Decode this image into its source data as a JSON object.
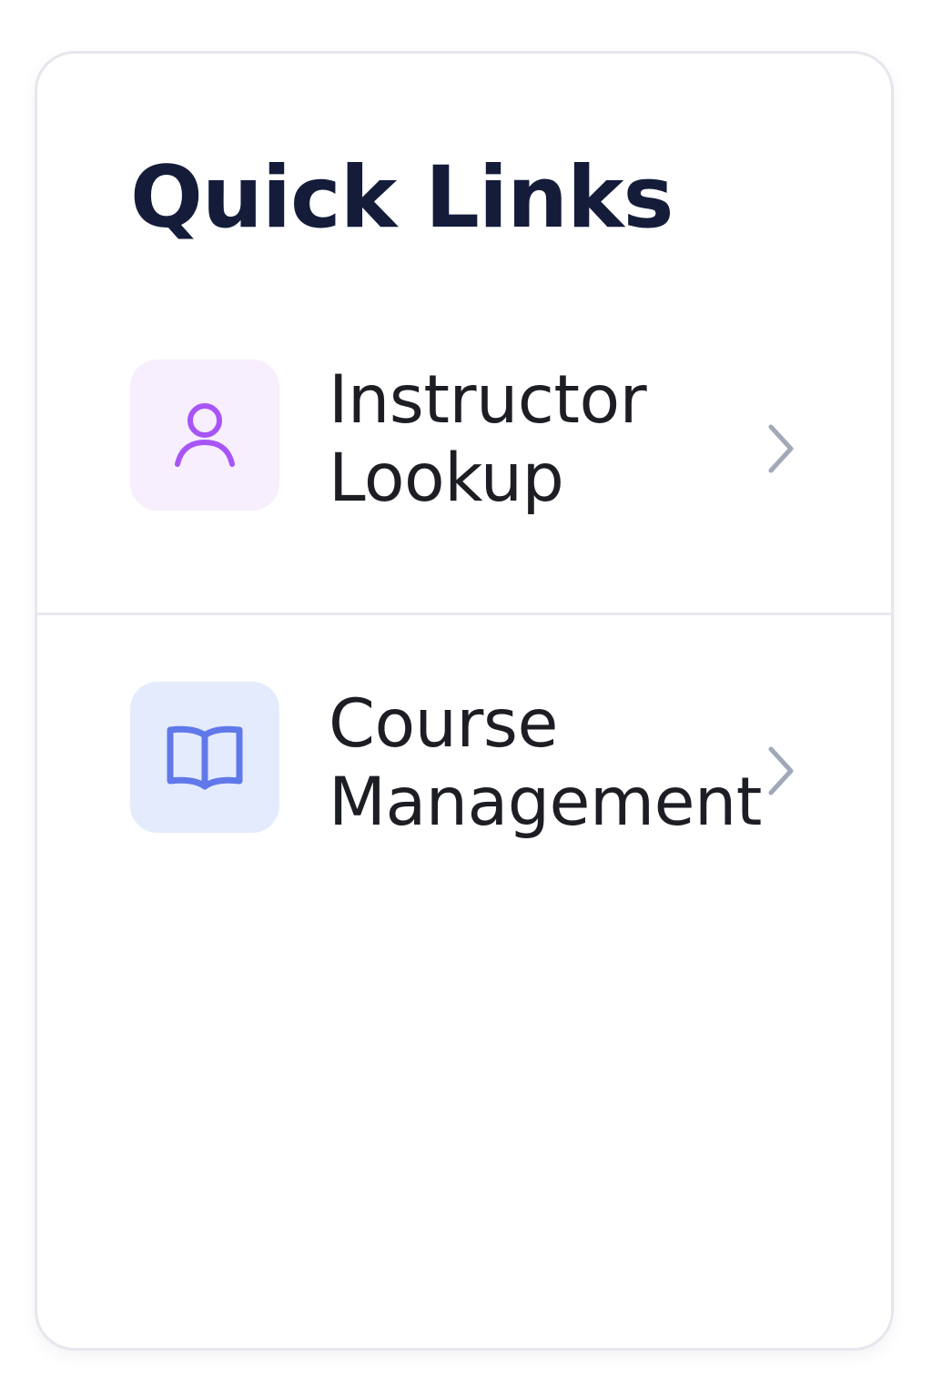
{
  "card": {
    "title": "Quick Links"
  },
  "links": [
    {
      "label_line1": "Instructor",
      "label_line2": "Lookup",
      "icon": "user-icon",
      "icon_color": "#a855f7",
      "tile_color": "#f7effd"
    },
    {
      "label_line1": "Course",
      "label_line2": "Management",
      "icon": "book-open-icon",
      "icon_color": "#6178ea",
      "tile_color": "#e4ebfd"
    }
  ],
  "colors": {
    "title": "#141c3a",
    "label": "#1c1e24",
    "chevron": "#a1a8b8",
    "border": "#e6e7ee"
  }
}
